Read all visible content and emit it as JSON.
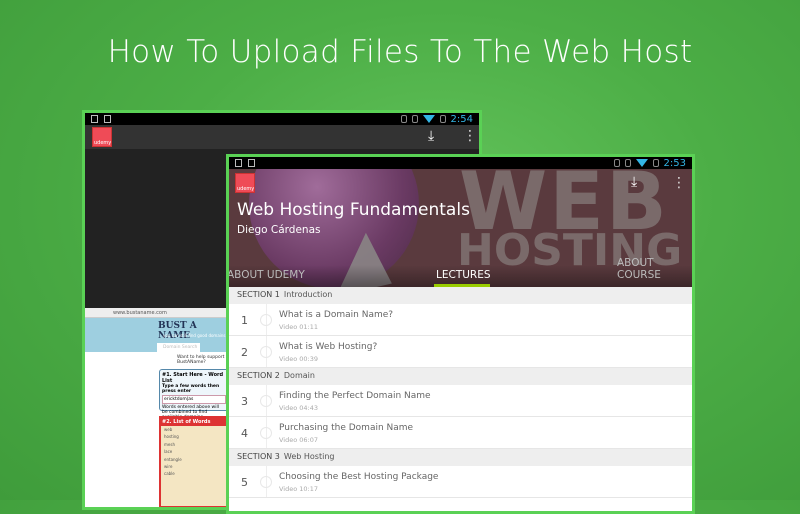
{
  "page_title": "How To Upload Files To The Web Host",
  "back_device": {
    "time": "2:54",
    "logo_text": "udemy",
    "browser_url": "www.bustaname.com",
    "site_name": "BUST A NAME",
    "site_tagline": "you can still find good domains",
    "tab_label": "Domain Search",
    "support_text": "Want to help support BustAName?",
    "box1_title": "#1. Start Here - Word List",
    "box1_sub": "Type a few words then press enter",
    "box1_input": "ericktdom|as",
    "box1_note": "Words entered above will be combined to find available domains.",
    "box2_title": "#2. List of Words",
    "words": [
      "web",
      "hosting",
      "mesh",
      "lace",
      "entangle",
      "wire",
      "cable"
    ]
  },
  "front_device": {
    "time": "2:53",
    "logo_text": "udemy",
    "course_title": "Web Hosting Fundamentals",
    "author": "Diego Cárdenas",
    "tabs": [
      "ABOUT UDEMY",
      "LECTURES",
      "ABOUT COURSE"
    ],
    "active_tab": "LECTURES",
    "list": [
      {
        "section": "SECTION 1",
        "name": "Introduction",
        "lectures": [
          {
            "num": "1",
            "title": "What is a Domain Name?",
            "meta": "Video 01:11"
          },
          {
            "num": "2",
            "title": "What is Web Hosting?",
            "meta": "Video 00:39"
          }
        ]
      },
      {
        "section": "SECTION 2",
        "name": "Domain",
        "lectures": [
          {
            "num": "3",
            "title": "Finding the Perfect Domain Name",
            "meta": "Video 04:43"
          },
          {
            "num": "4",
            "title": "Purchasing the Domain Name",
            "meta": "Video 06:07"
          }
        ]
      },
      {
        "section": "SECTION 3",
        "name": "Web Hosting",
        "lectures": [
          {
            "num": "5",
            "title": "Choosing the Best Hosting Package",
            "meta": "Video 10:17"
          }
        ]
      }
    ]
  },
  "colors": {
    "background": "#4cae46",
    "device_border": "#5ad155",
    "tab_indicator": "#99cc00",
    "clock": "#33b5e5",
    "logo": "#ef4b57"
  }
}
